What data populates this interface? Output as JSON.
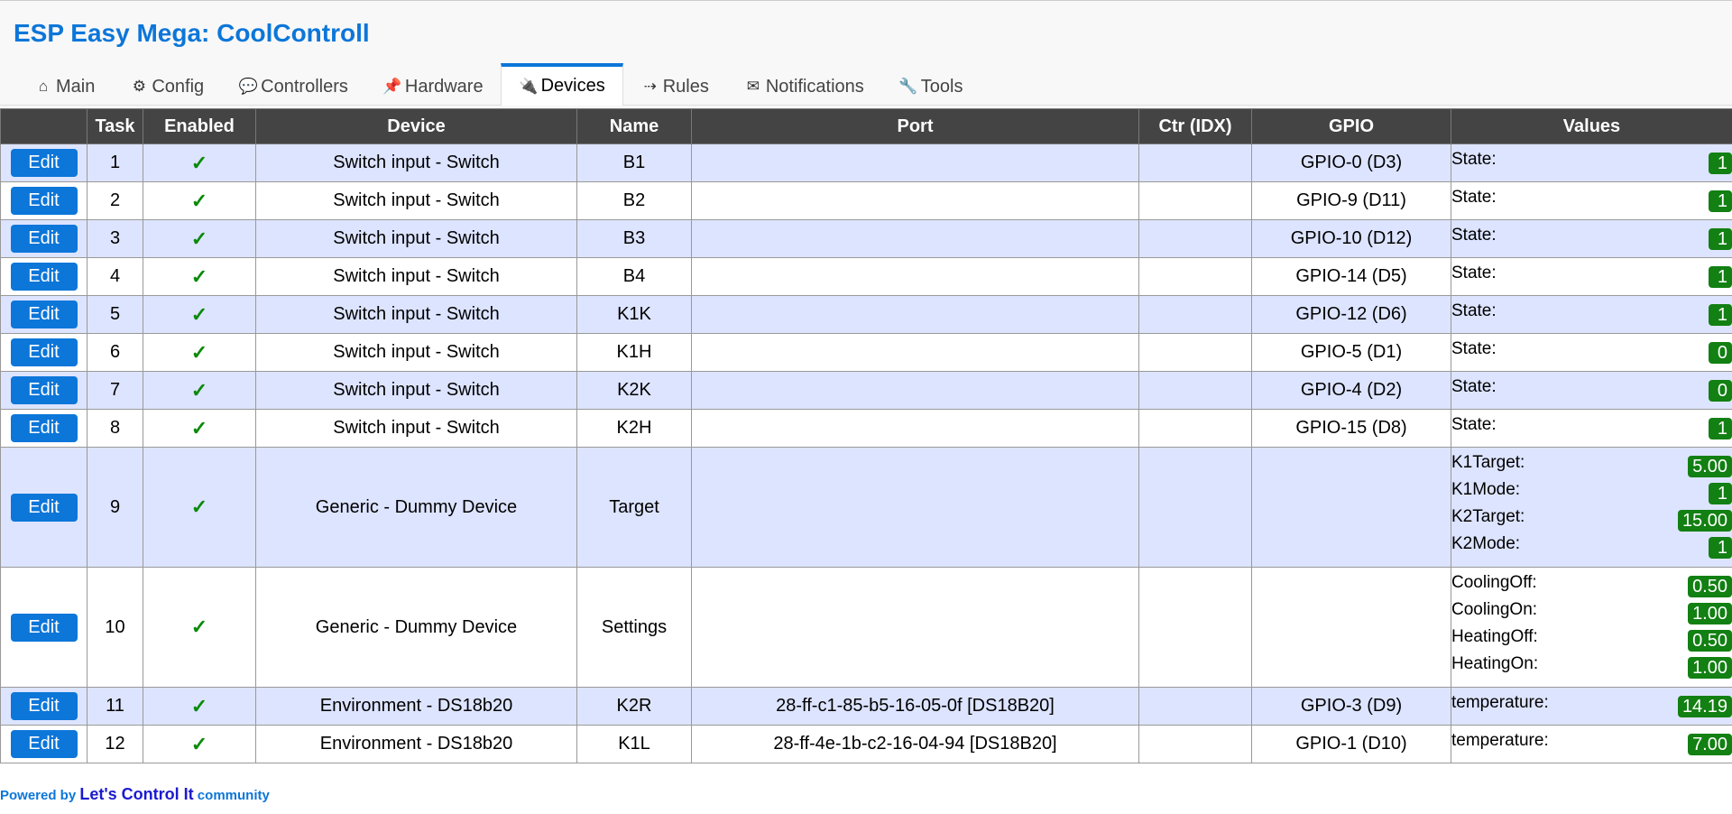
{
  "app": {
    "title": "ESP Easy Mega: CoolControll"
  },
  "tabs": [
    {
      "label": "Main",
      "icon": "home-icon",
      "glyph": "⌂",
      "active": false
    },
    {
      "label": "Config",
      "icon": "gear-icon",
      "glyph": "⚙",
      "active": false
    },
    {
      "label": "Controllers",
      "icon": "speech-bubble-icon",
      "glyph": "💬",
      "active": false
    },
    {
      "label": "Hardware",
      "icon": "pushpin-icon",
      "glyph": "📌",
      "active": false
    },
    {
      "label": "Devices",
      "icon": "plug-icon",
      "glyph": "🔌",
      "active": true
    },
    {
      "label": "Rules",
      "icon": "arrow-icon",
      "glyph": "⇢",
      "active": false
    },
    {
      "label": "Notifications",
      "icon": "envelope-icon",
      "glyph": "✉",
      "active": false
    },
    {
      "label": "Tools",
      "icon": "wrench-icon",
      "glyph": "🔧",
      "active": false
    }
  ],
  "table": {
    "headers": {
      "edit": "",
      "task": "Task",
      "enabled": "Enabled",
      "device": "Device",
      "name": "Name",
      "port": "Port",
      "ctr": "Ctr (IDX)",
      "gpio": "GPIO",
      "values": "Values"
    },
    "edit_label": "Edit",
    "enabled_mark": "✓",
    "rows": [
      {
        "task": "1",
        "device": "Switch input - Switch",
        "name": "B1",
        "port": "",
        "ctr": "",
        "gpio": "GPIO-0 (D3)",
        "values": [
          {
            "name": "State:",
            "value": "1"
          }
        ]
      },
      {
        "task": "2",
        "device": "Switch input - Switch",
        "name": "B2",
        "port": "",
        "ctr": "",
        "gpio": "GPIO-9 (D11)",
        "values": [
          {
            "name": "State:",
            "value": "1"
          }
        ]
      },
      {
        "task": "3",
        "device": "Switch input - Switch",
        "name": "B3",
        "port": "",
        "ctr": "",
        "gpio": "GPIO-10 (D12)",
        "values": [
          {
            "name": "State:",
            "value": "1"
          }
        ]
      },
      {
        "task": "4",
        "device": "Switch input - Switch",
        "name": "B4",
        "port": "",
        "ctr": "",
        "gpio": "GPIO-14 (D5)",
        "values": [
          {
            "name": "State:",
            "value": "1"
          }
        ]
      },
      {
        "task": "5",
        "device": "Switch input - Switch",
        "name": "K1K",
        "port": "",
        "ctr": "",
        "gpio": "GPIO-12 (D6)",
        "values": [
          {
            "name": "State:",
            "value": "1"
          }
        ]
      },
      {
        "task": "6",
        "device": "Switch input - Switch",
        "name": "K1H",
        "port": "",
        "ctr": "",
        "gpio": "GPIO-5 (D1)",
        "values": [
          {
            "name": "State:",
            "value": "0"
          }
        ]
      },
      {
        "task": "7",
        "device": "Switch input - Switch",
        "name": "K2K",
        "port": "",
        "ctr": "",
        "gpio": "GPIO-4 (D2)",
        "values": [
          {
            "name": "State:",
            "value": "0"
          }
        ]
      },
      {
        "task": "8",
        "device": "Switch input - Switch",
        "name": "K2H",
        "port": "",
        "ctr": "",
        "gpio": "GPIO-15 (D8)",
        "values": [
          {
            "name": "State:",
            "value": "1"
          }
        ]
      },
      {
        "task": "9",
        "device": "Generic - Dummy Device",
        "name": "Target",
        "port": "",
        "ctr": "",
        "gpio": "",
        "values": [
          {
            "name": "K1Target:",
            "value": "5.00"
          },
          {
            "name": "K1Mode:",
            "value": "1"
          },
          {
            "name": "K2Target:",
            "value": "15.00"
          },
          {
            "name": "K2Mode:",
            "value": "1"
          }
        ]
      },
      {
        "task": "10",
        "device": "Generic - Dummy Device",
        "name": "Settings",
        "port": "",
        "ctr": "",
        "gpio": "",
        "values": [
          {
            "name": "CoolingOff:",
            "value": "0.50"
          },
          {
            "name": "CoolingOn:",
            "value": "1.00"
          },
          {
            "name": "HeatingOff:",
            "value": "0.50"
          },
          {
            "name": "HeatingOn:",
            "value": "1.00"
          }
        ]
      },
      {
        "task": "11",
        "device": "Environment - DS18b20",
        "name": "K2R",
        "port": "28-ff-c1-85-b5-16-05-0f [DS18B20]",
        "ctr": "",
        "gpio": "GPIO-3 (D9)",
        "values": [
          {
            "name": "temperature:",
            "value": "14.19"
          }
        ]
      },
      {
        "task": "12",
        "device": "Environment - DS18b20",
        "name": "K1L",
        "port": "28-ff-4e-1b-c2-16-04-94 [DS18B20]",
        "ctr": "",
        "gpio": "GPIO-1 (D10)",
        "values": [
          {
            "name": "temperature:",
            "value": "7.00"
          }
        ]
      }
    ]
  },
  "footer": {
    "prefix": "Powered by ",
    "link": "Let's Control It",
    "suffix": " community"
  },
  "colors": {
    "accent": "#0c76d9",
    "header_bg": "#444444",
    "odd_row": "#dde4ff",
    "badge": "#128012"
  }
}
